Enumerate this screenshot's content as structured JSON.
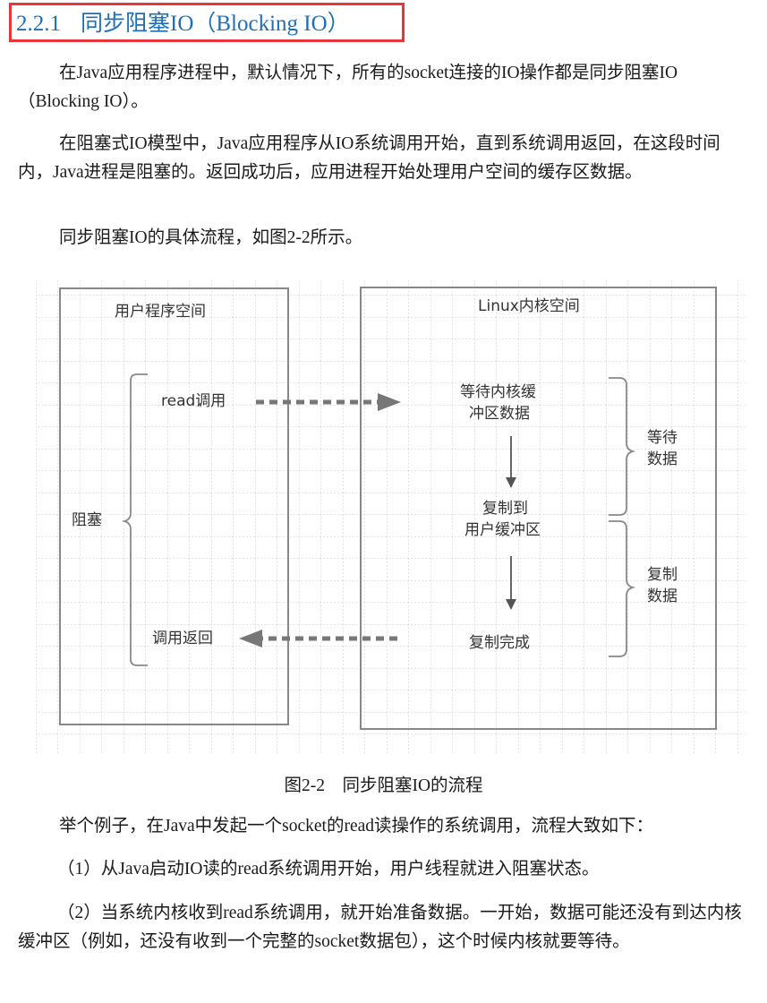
{
  "section": {
    "number": "2.2.1",
    "title": "同步阻塞IO（Blocking IO）"
  },
  "paragraphs": [
    "在Java应用程序进程中，默认情况下，所有的socket连接的IO操作都是同步阻塞IO（Blocking IO）。",
    "在阻塞式IO模型中，Java应用程序从IO系统调用开始，直到系统调用返回，在这段时间内，Java进程是阻塞的。返回成功后，应用进程开始处理用户空间的缓存区数据。",
    "同步阻塞IO的具体流程，如图2-2所示。"
  ],
  "figure": {
    "user_space_title": "用户程序空间",
    "kernel_space_title": "Linux内核空间",
    "blocking_label": "阻塞",
    "read_call_label": "read调用",
    "call_return_label": "调用返回",
    "kernel_steps": [
      [
        "等待内核缓",
        "冲区数据"
      ],
      [
        "复制到",
        "用户缓冲区"
      ],
      [
        "复制完成"
      ]
    ],
    "phase_wait": [
      "等待",
      "数据"
    ],
    "phase_copy": [
      "复制",
      "数据"
    ],
    "caption": "图2-2　同步阻塞IO的流程"
  },
  "after_paragraphs": [
    "举个例子，在Java中发起一个socket的read读操作的系统调用，流程大致如下：",
    "（1）从Java启动IO读的read系统调用开始，用户线程就进入阻塞状态。",
    "（2）当系统内核收到read系统调用，就开始准备数据。一开始，数据可能还没有到达内核缓冲区（例如，还没有收到一个完整的socket数据包），这个时候内核就要等待。"
  ],
  "colors": {
    "heading": "#1f6fb6",
    "heading_border": "#e8353b",
    "diagram_stroke": "#888888",
    "grid": "#c8c8c8"
  }
}
